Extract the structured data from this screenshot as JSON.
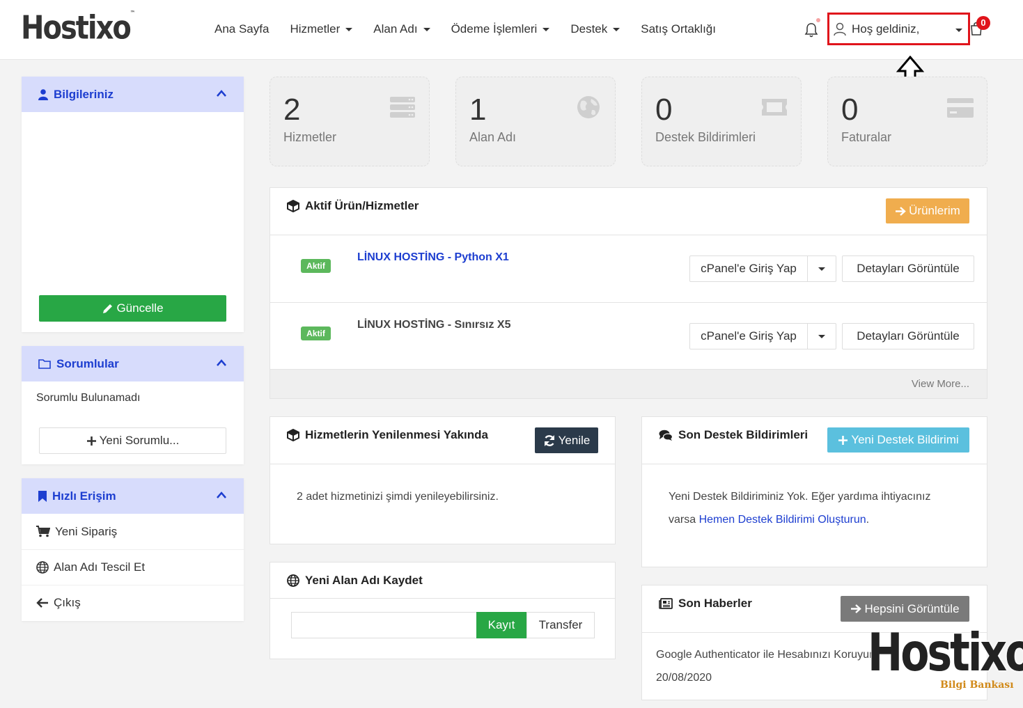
{
  "header": {
    "logo": "Hostixo",
    "logo_tm": "™",
    "nav": [
      {
        "label": "Ana Sayfa",
        "dropdown": false
      },
      {
        "label": "Hizmetler",
        "dropdown": true
      },
      {
        "label": "Alan Adı",
        "dropdown": true
      },
      {
        "label": "Ödeme İşlemleri",
        "dropdown": true
      },
      {
        "label": "Destek",
        "dropdown": true
      },
      {
        "label": "Satış Ortaklığı",
        "dropdown": false
      }
    ],
    "user_label": "Hoş geldiniz,",
    "cart_count": "0",
    "highlight_color": "#e0141b"
  },
  "sidebar": {
    "info_title": "Bilgileriniz",
    "update_button": "Güncelle",
    "contacts_title": "Sorumlular",
    "contacts_empty": "Sorumlu Bulunamadı",
    "new_contact_button": "Yeni Sorumlu...",
    "quick_title": "Hızlı Erişim",
    "quick_items": [
      "Yeni Sipariş",
      "Alan Adı Tescil Et",
      "Çıkış"
    ]
  },
  "stats": [
    {
      "value": "2",
      "label": "Hizmetler",
      "icon": "server-icon"
    },
    {
      "value": "1",
      "label": "Alan Adı",
      "icon": "globe-icon"
    },
    {
      "value": "0",
      "label": "Destek Bildirimleri",
      "icon": "ticket-icon"
    },
    {
      "value": "0",
      "label": "Faturalar",
      "icon": "credit-card-icon"
    }
  ],
  "active_services": {
    "title": "Aktif Ürün/Hizmetler",
    "button": "Ürünlerim",
    "items": [
      {
        "status": "Aktif",
        "name": "LİNUX HOSTİNG - Python X1",
        "login": "cPanel'e Giriş Yap",
        "details": "Detayları Görüntüle"
      },
      {
        "status": "Aktif",
        "name": "LİNUX HOSTİNG - Sınırsız X5",
        "login": "cPanel'e Giriş Yap",
        "details": "Detayları Görüntüle"
      }
    ],
    "view_more": "View More..."
  },
  "renewals": {
    "title": "Hizmetlerin Yenilenmesi Yakında",
    "button": "Yenile",
    "text": "2 adet hizmetinizi şimdi yenileyebilirsiniz."
  },
  "tickets": {
    "title": "Son Destek Bildirimleri",
    "button": "Yeni Destek Bildirimi",
    "text_line1": "Yeni Destek Bildiriminiz Yok. Eğer yardıma ihtiyacınız",
    "text_prefix": "varsa ",
    "link": "Hemen Destek Bildirimi Oluşturun",
    "text_suffix": "."
  },
  "domain": {
    "title": "Yeni Alan Adı Kaydet",
    "input_value": "",
    "register_button": "Kayıt",
    "transfer_button": "Transfer"
  },
  "news": {
    "title": "Son Haberler",
    "button": "Hepsini Görüntüle",
    "item_title": "Google Authenticator ile Hesabınızı Koruyun",
    "item_date": "20/08/2020"
  },
  "watermark": {
    "brand": "Hostixo",
    "subtitle": "Bilgi Bankası"
  }
}
